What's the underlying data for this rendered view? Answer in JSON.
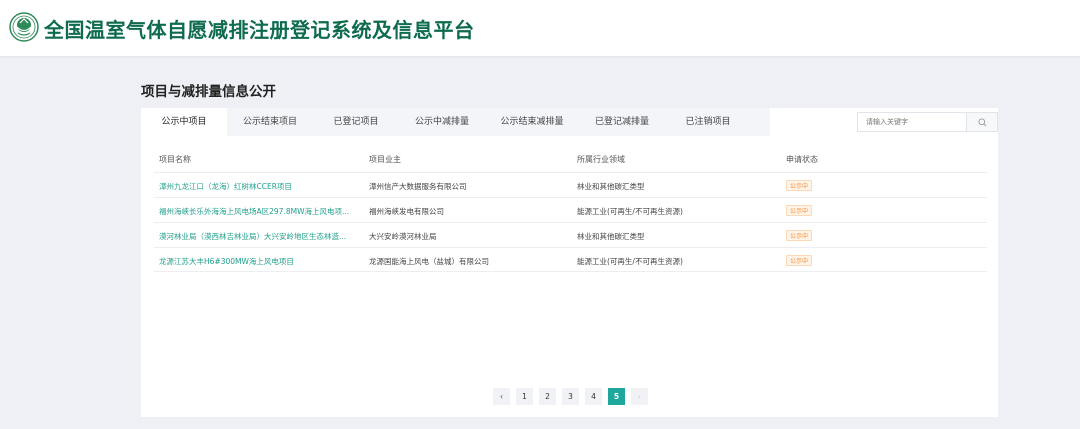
{
  "header": {
    "site_title": "全国温室气体自愿减排注册登记系统及信息平台",
    "logo_icon": "emblem-logo-icon"
  },
  "section_title": "项目与减排量信息公开",
  "tabs": [
    {
      "label": "公示中项目",
      "active": true
    },
    {
      "label": "公示结束项目",
      "active": false
    },
    {
      "label": "已登记项目",
      "active": false
    },
    {
      "label": "公示中减排量",
      "active": false
    },
    {
      "label": "公示结束减排量",
      "active": false
    },
    {
      "label": "已登记减排量",
      "active": false
    },
    {
      "label": "已注销项目",
      "active": false
    }
  ],
  "search": {
    "placeholder": "请输入关键字",
    "icon": "search-icon"
  },
  "table": {
    "columns": [
      "项目名称",
      "项目业主",
      "所属行业领域",
      "申请状态"
    ],
    "rows": [
      {
        "name": "漳州九龙江口（龙海）红树林CCER项目",
        "owner": "漳州信产大数据服务有限公司",
        "industry": "林业和其他碳汇类型",
        "status": "公示中"
      },
      {
        "name": "福州海峡长乐外海海上风电场A区297.8MW海上风电项...",
        "owner": "福州海峡发电有限公司",
        "industry": "能源工业(可再生/不可再生资源)",
        "status": "公示中"
      },
      {
        "name": "漠河林业局（漠西林吉林业局）大兴安岭地区生态林造...",
        "owner": "大兴安岭漠河林业局",
        "industry": "林业和其他碳汇类型",
        "status": "公示中"
      },
      {
        "name": "龙源江苏大丰H6#300MW海上风电项目",
        "owner": "龙源国能海上风电（盐城）有限公司",
        "industry": "能源工业(可再生/不可再生资源)",
        "status": "公示中"
      }
    ]
  },
  "pagination": {
    "prev": "‹",
    "pages": [
      "1",
      "2",
      "3",
      "4",
      "5"
    ],
    "current": "5",
    "next": "›"
  },
  "colors": {
    "brand_green": "#0e6b4f",
    "link_teal": "#1f9f8b",
    "active_page": "#1ea89d",
    "badge_orange": "#f08c3c"
  }
}
